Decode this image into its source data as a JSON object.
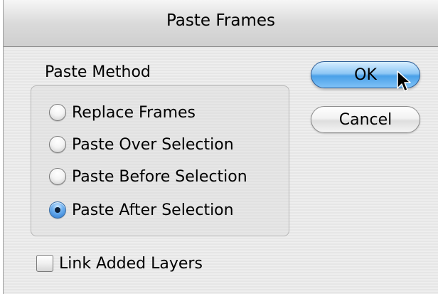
{
  "window": {
    "title": "Paste Frames"
  },
  "paste_method": {
    "label": "Paste Method",
    "options": [
      {
        "label": "Replace Frames",
        "selected": false
      },
      {
        "label": "Paste Over Selection",
        "selected": false
      },
      {
        "label": "Paste Before Selection",
        "selected": false
      },
      {
        "label": "Paste After Selection",
        "selected": true
      }
    ]
  },
  "buttons": {
    "ok_label": "OK",
    "cancel_label": "Cancel"
  },
  "link_layers": {
    "label": "Link Added Layers",
    "checked": false
  },
  "cursor": {
    "icon": "arrow-pointer-icon"
  },
  "colors": {
    "accent": "#4aa0e8",
    "window_bg": "#ececec"
  }
}
